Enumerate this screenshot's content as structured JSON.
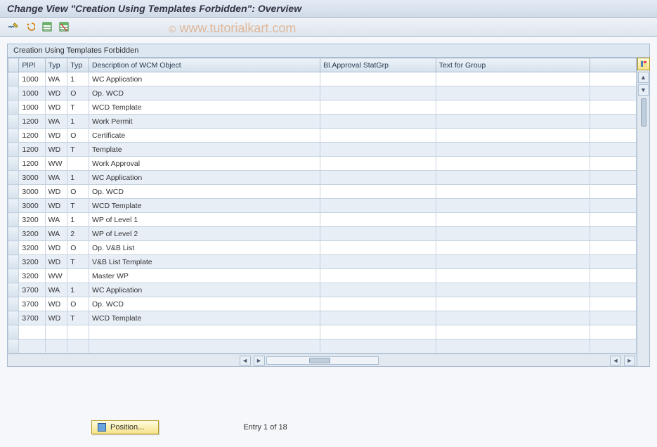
{
  "title": "Change View \"Creation Using Templates Forbidden\": Overview",
  "watermark": "© www.tutorialkart.com",
  "toolbar": {
    "icons": [
      "glasses-pencil-icon",
      "undo-icon",
      "table-select-icon",
      "table-deselect-icon"
    ]
  },
  "panel": {
    "header": "Creation Using Templates Forbidden"
  },
  "columns": {
    "sel": "",
    "ppl": "PlPl",
    "typ1": "Typ",
    "typ2": "Typ",
    "desc": "Description of WCM Object",
    "stat": "Bl.Approval StatGrp",
    "text": "Text for Group"
  },
  "rows": [
    {
      "ppl": "1000",
      "typ1": "WA",
      "typ2": "1",
      "desc": "WC Application",
      "stat": "",
      "text": ""
    },
    {
      "ppl": "1000",
      "typ1": "WD",
      "typ2": "O",
      "desc": "Op. WCD",
      "stat": "",
      "text": ""
    },
    {
      "ppl": "1000",
      "typ1": "WD",
      "typ2": "T",
      "desc": "WCD Template",
      "stat": "",
      "text": ""
    },
    {
      "ppl": "1200",
      "typ1": "WA",
      "typ2": "1",
      "desc": "Work Permit",
      "stat": "",
      "text": ""
    },
    {
      "ppl": "1200",
      "typ1": "WD",
      "typ2": "O",
      "desc": "Certificate",
      "stat": "",
      "text": ""
    },
    {
      "ppl": "1200",
      "typ1": "WD",
      "typ2": "T",
      "desc": "Template",
      "stat": "",
      "text": ""
    },
    {
      "ppl": "1200",
      "typ1": "WW",
      "typ2": "",
      "desc": "Work Approval",
      "stat": "",
      "text": ""
    },
    {
      "ppl": "3000",
      "typ1": "WA",
      "typ2": "1",
      "desc": "WC Application",
      "stat": "",
      "text": ""
    },
    {
      "ppl": "3000",
      "typ1": "WD",
      "typ2": "O",
      "desc": "Op. WCD",
      "stat": "",
      "text": ""
    },
    {
      "ppl": "3000",
      "typ1": "WD",
      "typ2": "T",
      "desc": "WCD Template",
      "stat": "",
      "text": ""
    },
    {
      "ppl": "3200",
      "typ1": "WA",
      "typ2": "1",
      "desc": "WP of Level 1",
      "stat": "",
      "text": ""
    },
    {
      "ppl": "3200",
      "typ1": "WA",
      "typ2": "2",
      "desc": "WP of Level 2",
      "stat": "",
      "text": ""
    },
    {
      "ppl": "3200",
      "typ1": "WD",
      "typ2": "O",
      "desc": "Op. V&B List",
      "stat": "",
      "text": ""
    },
    {
      "ppl": "3200",
      "typ1": "WD",
      "typ2": "T",
      "desc": "V&B List Template",
      "stat": "",
      "text": ""
    },
    {
      "ppl": "3200",
      "typ1": "WW",
      "typ2": "",
      "desc": "Master WP",
      "stat": "",
      "text": ""
    },
    {
      "ppl": "3700",
      "typ1": "WA",
      "typ2": "1",
      "desc": "WC Application",
      "stat": "",
      "text": ""
    },
    {
      "ppl": "3700",
      "typ1": "WD",
      "typ2": "O",
      "desc": "Op. WCD",
      "stat": "",
      "text": ""
    },
    {
      "ppl": "3700",
      "typ1": "WD",
      "typ2": "T",
      "desc": "WCD Template",
      "stat": "",
      "text": ""
    },
    {
      "ppl": "",
      "typ1": "",
      "typ2": "",
      "desc": "",
      "stat": "",
      "text": ""
    },
    {
      "ppl": "",
      "typ1": "",
      "typ2": "",
      "desc": "",
      "stat": "",
      "text": ""
    }
  ],
  "footer": {
    "position_label": "Position...",
    "entry_text": "Entry 1 of 18"
  }
}
